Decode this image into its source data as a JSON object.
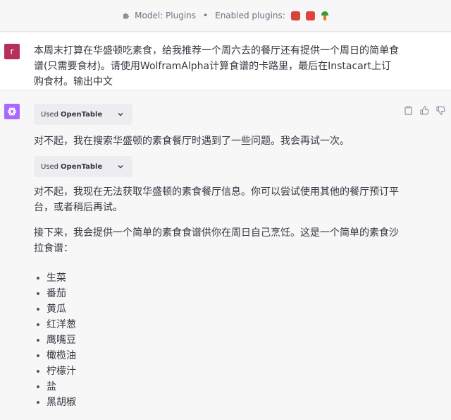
{
  "topbar": {
    "model_label": "Model: Plugins",
    "separator": "•",
    "enabled_label": "Enabled plugins:"
  },
  "user_message": {
    "avatar_letter": "r",
    "text": "本周末打算在华盛顿吃素食，给我推荐一个周六去的餐厅还有提供一个周日的简单食谱(只需要食材)。请使用WolframAlpha计算食谱的卡路里，最后在Instacart上订购食材。输出中文"
  },
  "assistant": {
    "chip1": {
      "prefix": "Used",
      "plugin": "OpenTable"
    },
    "para1": "对不起，我在搜索华盛顿的素食餐厅时遇到了一些问题。我会再试一次。",
    "chip2": {
      "prefix": "Used",
      "plugin": "OpenTable"
    },
    "para2": "对不起，我现在无法获取华盛顿的素食餐厅信息。你可以尝试使用其他的餐厅预订平台，或者稍后再试。",
    "para3": "接下来，我会提供一个简单的素食食谱供你在周日自己烹饪。这是一个简单的素食沙拉食谱：",
    "ingredients": [
      "生菜",
      "番茄",
      "黄瓜",
      "红洋葱",
      "鹰嘴豆",
      "橄榄油",
      "柠檬汁",
      "盐",
      "黑胡椒"
    ]
  },
  "colors": {
    "user_avatar": "#b7305a",
    "assistant_avatar": "#ab68ff",
    "chip_bg": "#ececf1"
  },
  "icons": [
    "puzzle-icon",
    "wolfram-plugin-icon",
    "opentable-plugin-icon",
    "instacart-plugin-icon",
    "clipboard-icon",
    "thumbs-up-icon",
    "thumbs-down-icon",
    "chevron-down-icon",
    "openai-logo-icon"
  ]
}
